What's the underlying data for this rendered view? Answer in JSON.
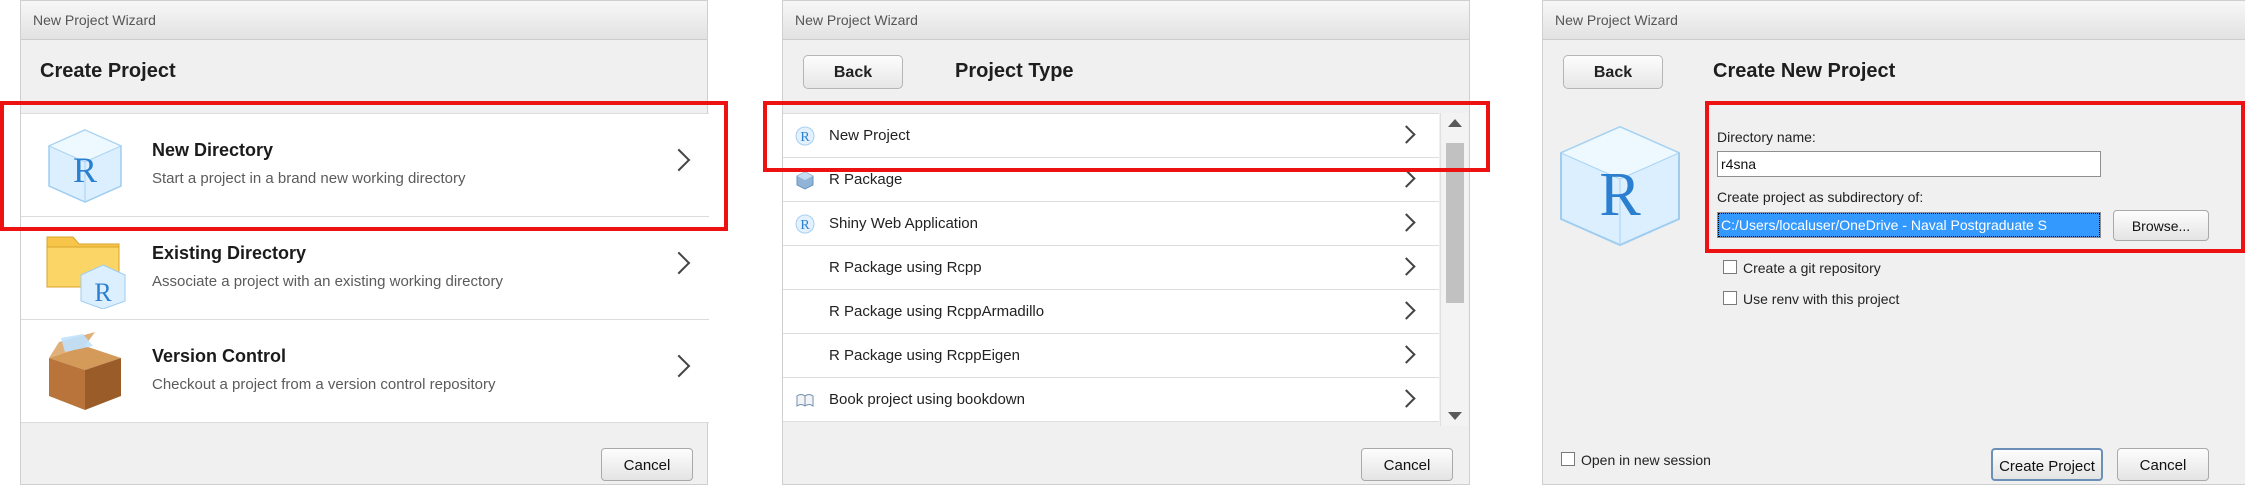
{
  "wizard1": {
    "window_title": "New Project Wizard",
    "heading": "Create Project",
    "options": [
      {
        "title": "New Directory",
        "description": "Start a project in a brand new working directory",
        "icon": "r-logo-cube-icon"
      },
      {
        "title": "Existing Directory",
        "description": "Associate a project with an existing working directory",
        "icon": "folder-r-icon"
      },
      {
        "title": "Version Control",
        "description": "Checkout a project from a version control repository",
        "icon": "cardboard-box-icon"
      }
    ],
    "cancel_label": "Cancel"
  },
  "wizard2": {
    "window_title": "New Project Wizard",
    "back_label": "Back",
    "heading": "Project Type",
    "types": [
      {
        "label": "New Project",
        "icon": "r-logo-icon"
      },
      {
        "label": "R Package",
        "icon": "package-icon"
      },
      {
        "label": "Shiny Web Application",
        "icon": "shiny-r-icon"
      },
      {
        "label": "R Package using Rcpp",
        "icon": ""
      },
      {
        "label": "R Package using RcppArmadillo",
        "icon": ""
      },
      {
        "label": "R Package using RcppEigen",
        "icon": ""
      },
      {
        "label": "Book project using bookdown",
        "icon": "book-icon"
      }
    ],
    "cancel_label": "Cancel"
  },
  "wizard3": {
    "window_title": "New Project Wizard",
    "back_label": "Back",
    "heading": "Create New Project",
    "directory_name_label": "Directory name:",
    "directory_name_value": "r4sna",
    "subdirectory_label": "Create project as subdirectory of:",
    "subdirectory_value": "C:/Users/localuser/OneDrive - Naval Postgraduate S",
    "browse_label": "Browse...",
    "git_checkbox_label": "Create a git repository",
    "renv_checkbox_label": "Use renv with this project",
    "open_new_session_label": "Open in new session",
    "create_label": "Create Project",
    "cancel_label": "Cancel"
  },
  "colors": {
    "highlight": "#ee1111",
    "selection": "#3399ff"
  }
}
